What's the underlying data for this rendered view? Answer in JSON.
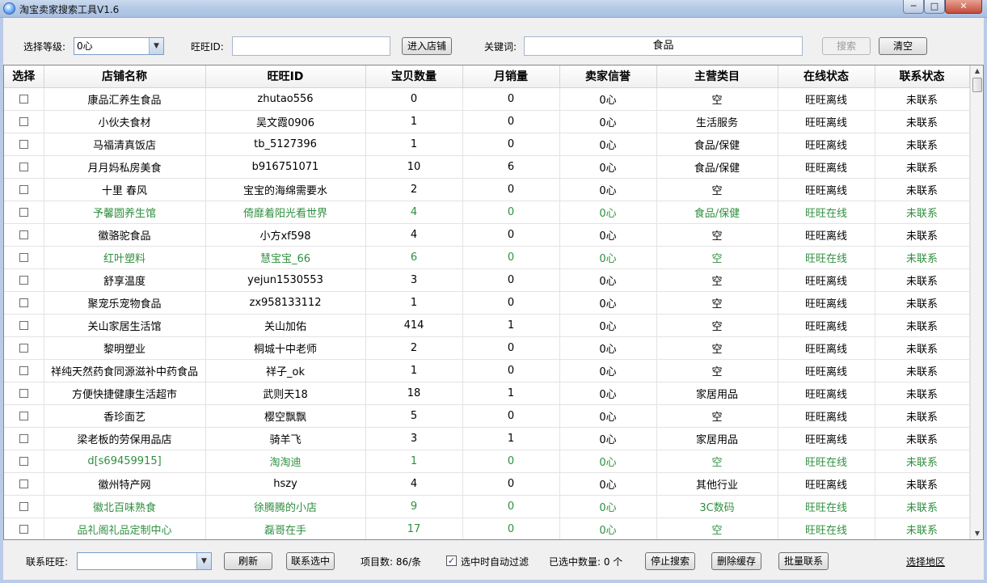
{
  "window": {
    "title": "淘宝卖家搜索工具V1.6",
    "minimize": "─",
    "maximize": "□",
    "close": "✕"
  },
  "toolbar": {
    "level_label": "选择等级:",
    "level_value": "0心",
    "wangwang_label": "旺旺ID:",
    "wangwang_value": "",
    "enter_shop": "进入店铺",
    "keyword_label": "关键词:",
    "keyword_value": "食品",
    "search": "搜索",
    "clear": "清空"
  },
  "table": {
    "columns": [
      "选择",
      "店铺名称",
      "旺旺ID",
      "宝贝数量",
      "月销量",
      "卖家信誉",
      "主营类目",
      "在线状态",
      "联系状态"
    ],
    "rows": [
      [
        "康品汇养生食品",
        "zhutao556",
        "0",
        "0",
        "0心",
        "空",
        "旺旺离线",
        "未联系",
        false
      ],
      [
        "小伙夫食材",
        "吴文霞0906",
        "1",
        "0",
        "0心",
        "生活服务",
        "旺旺离线",
        "未联系",
        false
      ],
      [
        "马福清真饭店",
        "tb_5127396",
        "1",
        "0",
        "0心",
        "食品/保健",
        "旺旺离线",
        "未联系",
        false
      ],
      [
        "月月妈私房美食",
        "b916751071",
        "10",
        "6",
        "0心",
        "食品/保健",
        "旺旺离线",
        "未联系",
        false
      ],
      [
        "十里 春风",
        "宝宝的海绵需要水",
        "2",
        "0",
        "0心",
        "空",
        "旺旺离线",
        "未联系",
        false
      ],
      [
        "予馨圆养生馆",
        "倚靡着阳光看世界",
        "4",
        "0",
        "0心",
        "食品/保健",
        "旺旺在线",
        "未联系",
        true
      ],
      [
        "徽骆驼食品",
        "小方xf598",
        "4",
        "0",
        "0心",
        "空",
        "旺旺离线",
        "未联系",
        false
      ],
      [
        "红叶塑料",
        "慧宝宝_66",
        "6",
        "0",
        "0心",
        "空",
        "旺旺在线",
        "未联系",
        true
      ],
      [
        "舒享温度",
        "yejun1530553",
        "3",
        "0",
        "0心",
        "空",
        "旺旺离线",
        "未联系",
        false
      ],
      [
        "聚宠乐宠物食品",
        "zx958133112",
        "1",
        "0",
        "0心",
        "空",
        "旺旺离线",
        "未联系",
        false
      ],
      [
        "关山家居生活馆",
        "关山加佑",
        "414",
        "1",
        "0心",
        "空",
        "旺旺离线",
        "未联系",
        false
      ],
      [
        "黎明塑业",
        "桐城十中老师",
        "2",
        "0",
        "0心",
        "空",
        "旺旺离线",
        "未联系",
        false
      ],
      [
        "祥纯天然药食同源滋补中药食品",
        "祥子_ok",
        "1",
        "0",
        "0心",
        "空",
        "旺旺离线",
        "未联系",
        false
      ],
      [
        "方便快捷健康生活超市",
        "武则天18",
        "18",
        "1",
        "0心",
        "家居用品",
        "旺旺离线",
        "未联系",
        false
      ],
      [
        "香珍面艺",
        "樱空飘飘",
        "5",
        "0",
        "0心",
        "空",
        "旺旺离线",
        "未联系",
        false
      ],
      [
        "梁老板的劳保用品店",
        "骑羊飞",
        "3",
        "1",
        "0心",
        "家居用品",
        "旺旺离线",
        "未联系",
        false
      ],
      [
        "d[s69459915]",
        "淘淘迪",
        "1",
        "0",
        "0心",
        "空",
        "旺旺在线",
        "未联系",
        true
      ],
      [
        "徽州特产网",
        "hszy",
        "4",
        "0",
        "0心",
        "其他行业",
        "旺旺离线",
        "未联系",
        false
      ],
      [
        "徽北百味熟食",
        "徐腾腾的小店",
        "9",
        "0",
        "0心",
        "3C数码",
        "旺旺在线",
        "未联系",
        true
      ],
      [
        "品礼阁礼品定制中心",
        "磊哥在手",
        "17",
        "0",
        "0心",
        "空",
        "旺旺在线",
        "未联系",
        true
      ]
    ]
  },
  "bottom": {
    "contact_label": "联系旺旺:",
    "contact_value": "",
    "refresh": "刷新",
    "contact_selected": "联系选中",
    "item_count": "项目数: 86/条",
    "auto_filter_label": "选中时自动过滤",
    "auto_filter_checked": true,
    "selected_count": "已选中数量: 0 个",
    "stop_search": "停止搜索",
    "delete_cache": "删除缓存",
    "batch_contact": "批量联系",
    "select_region": "选择地区"
  },
  "colors": {
    "online_row": "#2f8f3f",
    "offline_row": "#000000"
  }
}
